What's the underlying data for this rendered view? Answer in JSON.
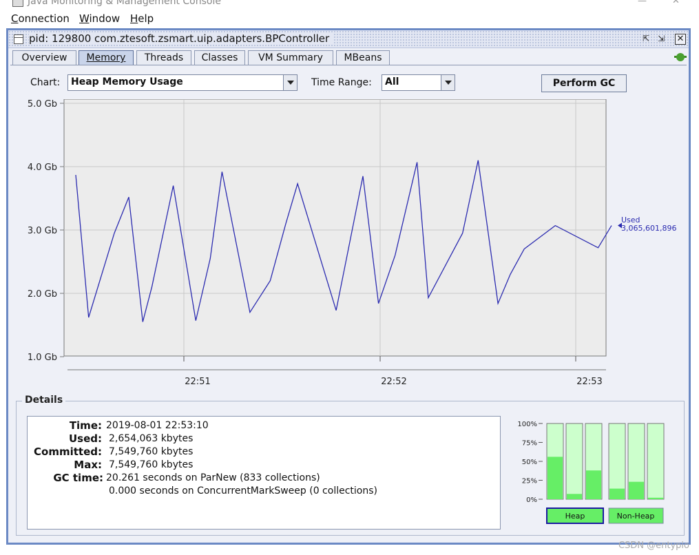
{
  "app": {
    "title": "Java Monitoring & Management Console"
  },
  "menubar": {
    "items": [
      {
        "label": "Connection",
        "mnemonic": "C"
      },
      {
        "label": "Window",
        "mnemonic": "W"
      },
      {
        "label": "Help",
        "mnemonic": "H"
      }
    ]
  },
  "window": {
    "title": "pid: 129800 com.ztesoft.zsmart.uip.adapters.BPController"
  },
  "tabs": [
    {
      "label": "Overview",
      "active": false
    },
    {
      "label": "Memory",
      "active": true
    },
    {
      "label": "Threads",
      "active": false
    },
    {
      "label": "Classes",
      "active": false
    },
    {
      "label": "VM Summary",
      "active": false
    },
    {
      "label": "MBeans",
      "active": false
    }
  ],
  "controls": {
    "chart_label": "Chart:",
    "chart_value": "Heap Memory Usage",
    "time_range_label": "Time Range:",
    "time_range_value": "All",
    "perform_gc": "Perform GC"
  },
  "chart_data": {
    "type": "line",
    "title": "",
    "y_ticks": [
      "1.0 Gb",
      "2.0 Gb",
      "3.0 Gb",
      "4.0 Gb",
      "5.0 Gb"
    ],
    "ylim": [
      1.0,
      5.0
    ],
    "x_ticks": [
      "22:51",
      "22:52",
      "22:53"
    ],
    "series": [
      {
        "name": "Used",
        "color": "#2b2bb0",
        "x": [
          0.0,
          0.024,
          0.072,
          0.099,
          0.125,
          0.142,
          0.182,
          0.224,
          0.251,
          0.273,
          0.325,
          0.363,
          0.392,
          0.414,
          0.486,
          0.536,
          0.565,
          0.596,
          0.637,
          0.658,
          0.722,
          0.751,
          0.788,
          0.811,
          0.837,
          0.895,
          0.922,
          0.947,
          0.971,
          1.0
        ],
        "values": [
          3.87,
          1.62,
          2.95,
          3.52,
          1.55,
          2.1,
          3.7,
          1.57,
          2.55,
          3.92,
          1.7,
          2.2,
          3.1,
          3.73,
          1.73,
          3.85,
          1.84,
          2.6,
          4.07,
          1.93,
          2.95,
          4.1,
          1.84,
          2.3,
          2.7,
          3.07,
          3.07,
          3.07,
          3.07,
          3.07
        ],
        "label_text": "Used",
        "label_value": "3,065,601,896"
      }
    ]
  },
  "details": {
    "title": "Details",
    "rows": [
      {
        "key": "Time:",
        "value": "2019-08-01 22:53:10"
      },
      {
        "key": "Used:",
        "value": "2,654,063 kbytes"
      },
      {
        "key": "Committed:",
        "value": "7,549,760 kbytes"
      },
      {
        "key": "Max:",
        "value": "7,549,760 kbytes"
      },
      {
        "key": "GC time:",
        "value": "20.261 seconds on ParNew (833 collections)"
      },
      {
        "key": "",
        "value": "0.000 seconds on ConcurrentMarkSweep (0 collections)"
      }
    ]
  },
  "pool_bars": {
    "y_ticks": [
      "100%",
      "75%",
      "50%",
      "25%",
      "0%"
    ],
    "heap_label": "Heap",
    "nonheap_label": "Non-Heap",
    "heap_fill": [
      0.56,
      0.07,
      0.38
    ],
    "nonheap_fill": [
      0.14,
      0.23,
      0.02
    ]
  },
  "watermark": "CSDN @entypio"
}
